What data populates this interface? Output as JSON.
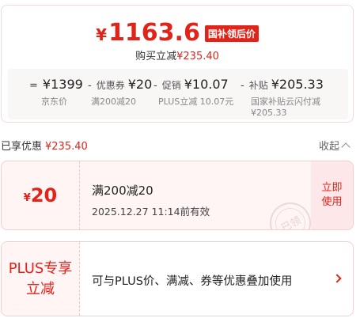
{
  "price": {
    "symbol": "¥",
    "amount": "1163.6",
    "badge": "国补领后价",
    "reduce_label": "购买立减",
    "reduce_amount": "¥235.40"
  },
  "breakdown": [
    {
      "op": "=",
      "label": "",
      "value": "¥1399",
      "sub": "京东价",
      "sub2": ""
    },
    {
      "op": "-",
      "label": "优惠券",
      "value": "¥20",
      "sub": "满200减20",
      "sub2": ""
    },
    {
      "op": "-",
      "label": "促销",
      "value": "¥10.07",
      "sub": "PLUS立减 10.07元",
      "sub2": ""
    },
    {
      "op": "-",
      "label": "补贴",
      "value": "¥205.33",
      "sub": "国家补贴云闪付减",
      "sub2": "¥205.33"
    }
  ],
  "coupon_header": {
    "title": "已享优惠",
    "amount": "¥235.40",
    "collapse_label": "收起"
  },
  "coupon1": {
    "symbol": "¥",
    "value": "20",
    "condition": "满200减20",
    "expiry": "2025.12.27 11:14前有效",
    "action_line1": "立即",
    "action_line2": "使用",
    "stamp_text": "已领"
  },
  "coupon2": {
    "tag_line1": "PLUS专享",
    "tag_line2": "立减",
    "description": "可与PLUS价、满减、券等优惠叠加使用"
  },
  "colors": {
    "accent": "#e2231a",
    "coupon_bg": "#fff5f5",
    "action_bg": "#fde7e8"
  }
}
